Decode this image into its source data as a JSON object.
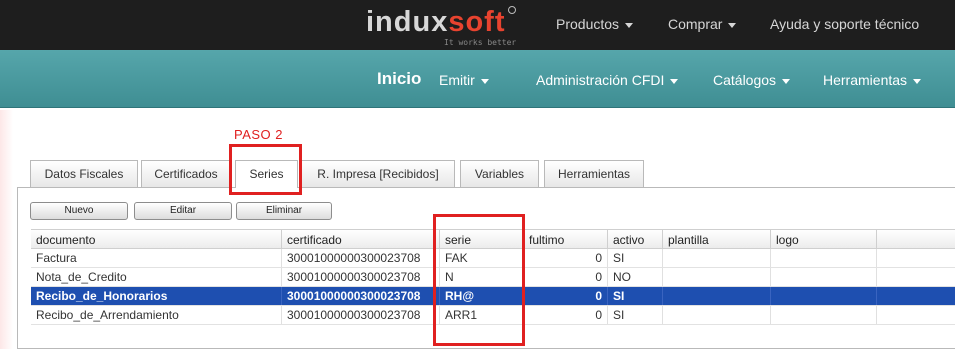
{
  "brand": {
    "name_part1": "indux",
    "name_part2": "soft",
    "tagline": "It works better"
  },
  "top_nav": [
    {
      "label": "Productos"
    },
    {
      "label": "Comprar"
    },
    {
      "label": "Ayuda y soporte técnico"
    }
  ],
  "main_nav": [
    {
      "label": "Inicio"
    },
    {
      "label": "Emitir"
    },
    {
      "label": "Administración CFDI"
    },
    {
      "label": "Catálogos"
    },
    {
      "label": "Herramientas"
    }
  ],
  "annotation": {
    "step_label": "PASO 2"
  },
  "tabs": [
    {
      "label": "Datos Fiscales",
      "active": false
    },
    {
      "label": "Certificados",
      "active": false
    },
    {
      "label": "Series",
      "active": true
    },
    {
      "label": "R. Impresa [Recibidos]",
      "active": false
    },
    {
      "label": "Variables",
      "active": false
    },
    {
      "label": "Herramientas",
      "active": false
    }
  ],
  "toolbar": {
    "new_label": "Nuevo",
    "edit_label": "Editar",
    "delete_label": "Eliminar"
  },
  "table": {
    "columns": [
      "documento",
      "certificado",
      "serie",
      "fultimo",
      "activo",
      "plantilla",
      "logo"
    ],
    "rows": [
      {
        "documento": "Factura",
        "certificado": "30001000000300023708",
        "serie": "FAK",
        "fultimo": "0",
        "activo": "SI",
        "plantilla": "",
        "logo": "",
        "selected": false
      },
      {
        "documento": "Nota_de_Credito",
        "certificado": "30001000000300023708",
        "serie": "N",
        "fultimo": "0",
        "activo": "NO",
        "plantilla": "",
        "logo": "",
        "selected": false
      },
      {
        "documento": "Recibo_de_Honorarios",
        "certificado": "30001000000300023708",
        "serie": "RH@",
        "fultimo": "0",
        "activo": "SI",
        "plantilla": "",
        "logo": "",
        "selected": true
      },
      {
        "documento": "Recibo_de_Arrendamiento",
        "certificado": "30001000000300023708",
        "serie": "ARR1",
        "fultimo": "0",
        "activo": "SI",
        "plantilla": "",
        "logo": "",
        "selected": false
      }
    ]
  },
  "colors": {
    "top_bar": "#1e1e1e",
    "nav_bar": "#4a9ba0",
    "brand_accent": "#e8432f",
    "selection": "#1e4fb0",
    "annotation_red": "#e02020"
  }
}
